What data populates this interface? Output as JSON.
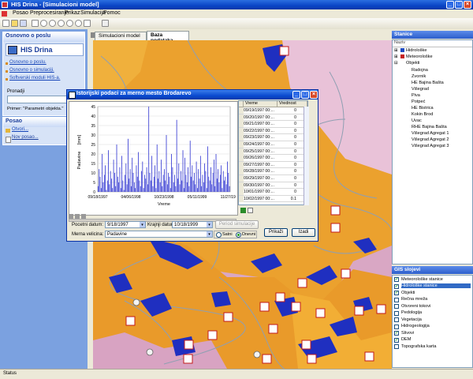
{
  "window": {
    "title": "HIS Drina - [Simulacioni model]"
  },
  "menu": [
    "Posao",
    "Preprocesiranje",
    "Prikaz",
    "Simulacija",
    "Pomoc"
  ],
  "left_panel": {
    "section1_title": "Osnovno o poslu",
    "app_name": "HIS Drina",
    "links": [
      "Osnovno o poslu.",
      "Osnovno o simulaciji.",
      "Softverski moduli HIS-a."
    ],
    "search_label": "Pronadji",
    "example": "Primer: \"Parametri objekta.\"",
    "section2_title": "Posao",
    "posao_items": [
      "Otvori...",
      "Nov posao..."
    ]
  },
  "tabs": [
    "Simulacioni model",
    "Baza podataka"
  ],
  "right_panel": {
    "stanice_title": "Stanice",
    "naziv_label": "Naziv",
    "tree": [
      "Hidrološke",
      "Meteorološke",
      "Objekti"
    ],
    "objects": [
      "Radojna",
      "Zvornik",
      "HE Bajina Bašta",
      "Višegrad",
      "Piva",
      "Potpeć",
      "HE Bistrica",
      "Kokin Brod",
      "Uvac",
      "RHE Bajina Bašta",
      "Višegrad Agregat 1",
      "Višegrad Agregat 2",
      "Višegrad Agregat 3"
    ],
    "gis_title": "GIS slojevi",
    "layers": [
      {
        "name": "Meteorološke stanice",
        "checked": true
      },
      {
        "name": "Hidrološke stanice",
        "checked": true,
        "selected": true
      },
      {
        "name": "Objekti",
        "checked": true
      },
      {
        "name": "Rečna mreža",
        "checked": false
      },
      {
        "name": "Otvoreni tokovi",
        "checked": false
      },
      {
        "name": "Pedologija",
        "checked": false
      },
      {
        "name": "Vegetacija",
        "checked": false
      },
      {
        "name": "Hidrogeologija",
        "checked": false
      },
      {
        "name": "Slivovi",
        "checked": true
      },
      {
        "name": "DEM",
        "checked": true
      },
      {
        "name": "Topografska karta",
        "checked": false
      }
    ]
  },
  "status": "Status",
  "dialog": {
    "title": "Istorijski podaci za merno mesto Brodarevo",
    "chart_ylabel1": "[mm]",
    "chart_ylabel2": "Padavine",
    "xlabel": "Vreme",
    "grid_headers": [
      "Vreme",
      "Vrednost"
    ],
    "grid_rows": [
      [
        "09/19/1997 00:...",
        "0"
      ],
      [
        "09/20/1997 00:...",
        "0"
      ],
      [
        "09/21/1997 00:...",
        "0"
      ],
      [
        "09/22/1997 00:...",
        "0"
      ],
      [
        "09/23/1997 00:...",
        "0"
      ],
      [
        "09/24/1997 00:...",
        "0"
      ],
      [
        "09/25/1997 00:...",
        "0"
      ],
      [
        "09/26/1997 00:...",
        "0"
      ],
      [
        "09/27/1997 00:...",
        "0"
      ],
      [
        "09/28/1997 00:...",
        "0"
      ],
      [
        "09/29/1997 00:...",
        "0"
      ],
      [
        "09/30/1997 00:...",
        "0"
      ],
      [
        "10/01/1997 00:...",
        "0"
      ],
      [
        "10/02/1997 00:...",
        "0.1"
      ]
    ],
    "start_label": "Pocetni datum:",
    "start_value": "9/18/1997",
    "end_label": "Krajnji datum:",
    "end_value": "10/18/1999",
    "period_label": "Period simulacije",
    "measure_label": "Merna velicina:",
    "measure_value": "Padavine",
    "radio_hourly": "Satni",
    "radio_daily": "Dnevni",
    "show_button": "Prikaži",
    "exit_button": "Izadi"
  },
  "chart_data": {
    "type": "bar",
    "ylabel": "[mm] Padavine",
    "xlabel": "Vreme",
    "x_ticks": [
      "09/18/1997",
      "04/06/1998",
      "10/23/1998",
      "05/11/1999",
      "11/27/1999"
    ],
    "y_ticks": [
      0,
      5,
      10,
      15,
      20,
      25,
      30,
      35,
      40,
      45
    ],
    "ylim": [
      0,
      45
    ],
    "values": [
      3,
      12,
      8,
      2,
      20,
      5,
      9,
      14,
      1,
      6,
      22,
      4,
      11,
      7,
      2,
      17,
      10,
      3,
      25,
      8,
      5,
      13,
      2,
      19,
      6,
      1,
      9,
      15,
      4,
      28,
      7,
      12,
      3,
      18,
      10,
      5,
      2,
      14,
      8,
      21,
      6,
      3,
      11,
      16,
      2,
      9,
      7,
      13,
      4,
      45,
      10,
      6,
      19,
      3,
      8,
      14,
      2,
      25,
      7,
      11,
      5,
      17,
      3,
      9,
      12,
      6,
      30,
      4,
      10,
      8,
      2,
      20,
      13,
      5,
      9,
      3,
      38,
      7,
      15,
      4,
      11,
      6,
      22,
      2,
      18,
      9,
      5,
      13,
      3,
      27,
      8,
      14,
      6,
      10,
      4,
      16,
      2,
      12,
      7,
      19,
      3,
      9,
      5,
      15,
      11,
      2,
      24,
      8,
      6,
      13,
      4,
      10,
      17,
      3,
      20,
      7,
      12,
      5,
      9,
      14,
      2,
      11,
      6,
      8,
      4,
      16,
      10,
      3
    ]
  }
}
